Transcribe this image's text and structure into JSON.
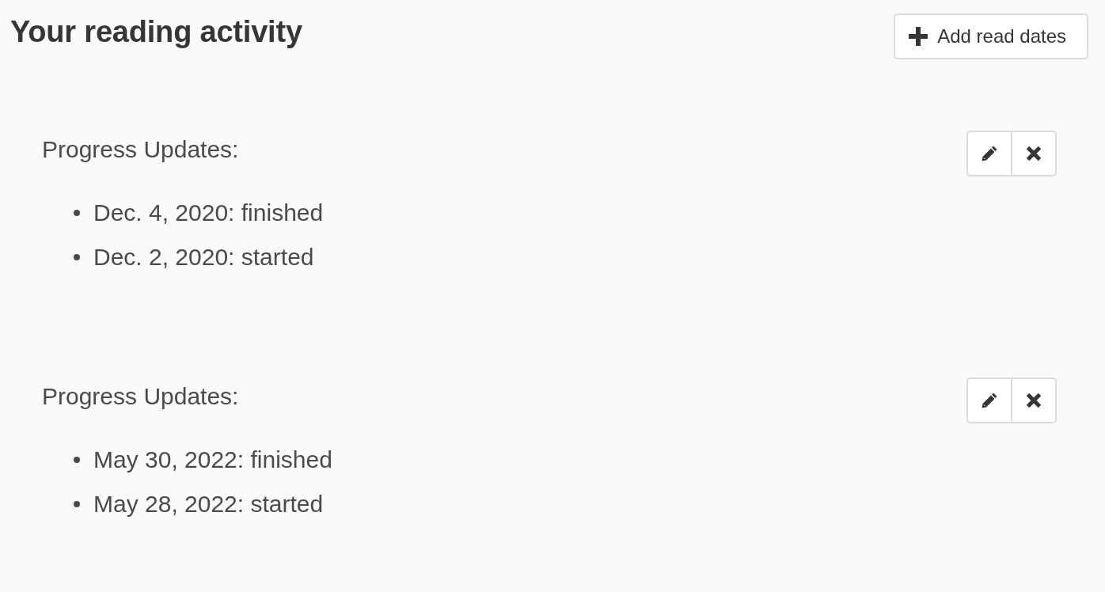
{
  "page": {
    "title": "Your reading activity"
  },
  "add_button": {
    "label": "Add read dates"
  },
  "readthroughs": [
    {
      "heading": "Progress Updates:",
      "updates": [
        "Dec. 4, 2020: finished",
        "Dec. 2, 2020: started"
      ]
    },
    {
      "heading": "Progress Updates:",
      "updates": [
        "May 30, 2022: finished",
        "May 28, 2022: started"
      ]
    }
  ]
}
